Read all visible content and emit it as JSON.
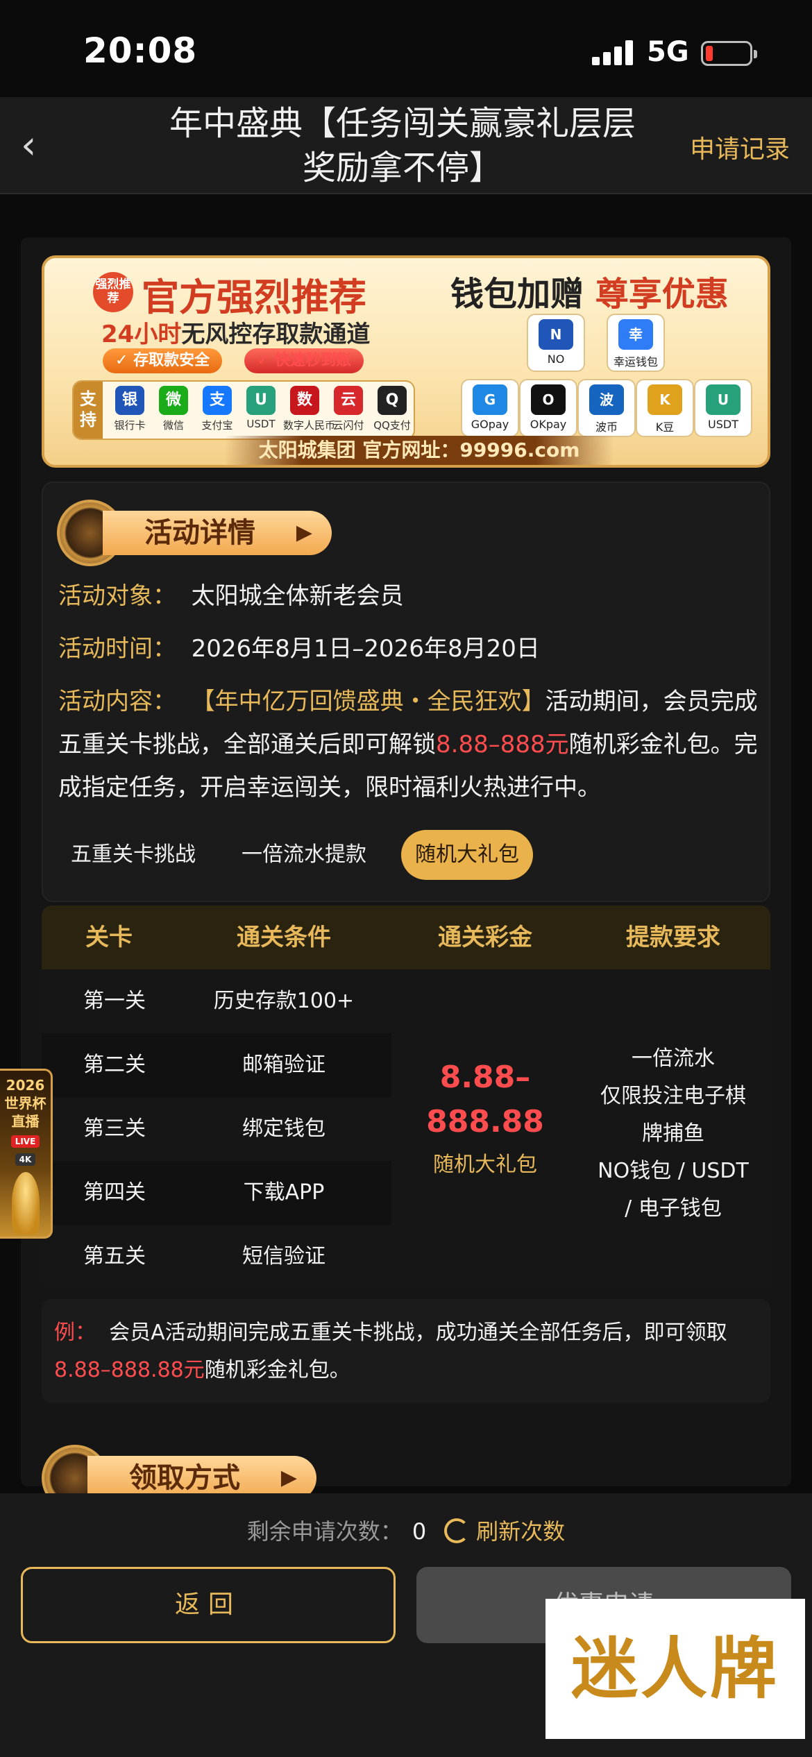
{
  "status_bar": {
    "time": "20:08",
    "network": "5G"
  },
  "nav": {
    "title": "年中盛典【任务闯关赢豪礼层层奖励拿不停】",
    "right_link": "申请记录"
  },
  "banner": {
    "badge": "强烈推荐",
    "headline": "官方强烈推荐",
    "sub_prefix": "24小时",
    "sub_rest": "无风控存取款通道",
    "pill_1": "存取款安全",
    "pill_2": "快速秒到账",
    "support_label": "支持",
    "payments": [
      {
        "label": "银行卡",
        "icon": "bank-card-icon",
        "color": "#1f56b8"
      },
      {
        "label": "微信",
        "icon": "wechat-icon",
        "color": "#1aad19"
      },
      {
        "label": "支付宝",
        "icon": "alipay-icon",
        "color": "#1677ff"
      },
      {
        "label": "USDT",
        "icon": "usdt-icon",
        "color": "#26a17b"
      },
      {
        "label": "数字人民币",
        "icon": "digital-rmb-icon",
        "color": "#c8161d"
      },
      {
        "label": "云闪付",
        "icon": "unionpay-icon",
        "color": "#d7282c"
      },
      {
        "label": "QQ支付",
        "icon": "qq-icon",
        "color": "#222222"
      }
    ],
    "wallet_title_prefix": "钱包加赠",
    "wallet_title_highlight": "尊享优惠",
    "wallets": [
      {
        "label": "NO",
        "icon": "no-wallet-icon",
        "color": "#1f56b8"
      },
      {
        "label": "幸运钱包",
        "icon": "lucky-wallet-icon",
        "color": "#2f7df6"
      },
      {
        "label": "GOpay",
        "icon": "gopay-icon",
        "color": "#1e88e5"
      },
      {
        "label": "OKpay",
        "icon": "okpay-icon",
        "color": "#111111"
      },
      {
        "label": "波币",
        "icon": "bobi-icon",
        "color": "#1565c0"
      },
      {
        "label": "K豆",
        "icon": "kdou-icon",
        "color": "#e0a21c"
      },
      {
        "label": "USDT",
        "icon": "usdt-wallet-icon",
        "color": "#26a17b"
      }
    ],
    "footer": "太阳城集团 官方网址：99996.com"
  },
  "details": {
    "section_title": "活动详情",
    "target_label": "活动对象：",
    "target_value": "太阳城全体新老会员",
    "time_label": "活动时间：",
    "time_value": "2026年8月1日–2026年8月20日",
    "content_label": "活动内容：",
    "content_highlight": "【年中亿万回馈盛典・全民狂欢】",
    "content_part1": "活动期间，会员完成五重关卡挑战，全部通关后即可解锁",
    "content_amount": "8.88–888元",
    "content_part2": "随机彩金礼包。完成指定任务，开启幸运闯关，限时福利火热进行中。",
    "tabs": [
      "五重关卡挑战",
      "一倍流水提款",
      "随机大礼包"
    ]
  },
  "table": {
    "headers": [
      "关卡",
      "通关条件",
      "通关彩金",
      "提款要求"
    ],
    "rows": [
      {
        "level": "第一关",
        "condition": "历史存款100+"
      },
      {
        "level": "第二关",
        "condition": "邮箱验证"
      },
      {
        "level": "第三关",
        "condition": "绑定钱包"
      },
      {
        "level": "第四关",
        "condition": "下载APP"
      },
      {
        "level": "第五关",
        "condition": "短信验证"
      }
    ],
    "prize_line1": "8.88–",
    "prize_line2": "888.88",
    "prize_label": "随机大礼包",
    "requirement_lines": [
      "一倍流水",
      "仅限投注电子棋",
      "牌捕鱼",
      "NO钱包 / USDT",
      "/ 电子钱包"
    ]
  },
  "example": {
    "label": "例：",
    "text": "会员A活动期间完成五重关卡挑战，成功通关全部任务后，即可领取",
    "amount": "8.88–888.88元",
    "text_end": "随机彩金礼包。"
  },
  "claim_section_title": "领取方式",
  "worldcup": {
    "year": "2026",
    "title_1": "世界杯",
    "title_2": "直播",
    "live": "LIVE",
    "quality": "4K"
  },
  "bottom": {
    "remaining_label": "剩余申请次数：",
    "remaining_count": "0",
    "refresh_label": "刷新次数",
    "back_button": "返回",
    "apply_button": "优惠申请"
  },
  "watermark": "迷人牌"
}
